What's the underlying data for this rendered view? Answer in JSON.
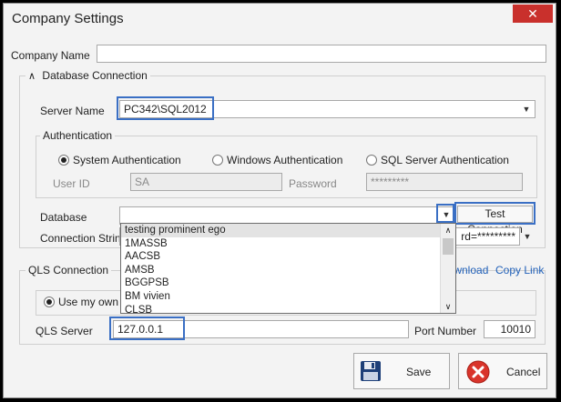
{
  "window": {
    "title": "Company Settings",
    "close_glyph": "✕"
  },
  "company": {
    "label": "Company Name",
    "value": ""
  },
  "db": {
    "group_label": "Database Connection",
    "collapse_glyph": "∧",
    "server_label": "Server Name",
    "server_value": "PC342\\SQL2012",
    "auth": {
      "group_label": "Authentication",
      "options": [
        "System Authentication",
        "Windows Authentication",
        "SQL Server Authentication"
      ],
      "selected": "System Authentication",
      "userid_label": "User ID",
      "userid_value": "SA",
      "password_label": "Password",
      "password_value": "*********"
    },
    "database_label": "Database",
    "database_value": "",
    "test_button": "Test Connection",
    "conn_label": "Connection String",
    "conn_value": "rd=*********",
    "dropdown_items": [
      "testing prominent ego",
      "1MASSB",
      "AACSB",
      "AMSB",
      "BGGPSB",
      "BM vivien",
      "CLSB"
    ]
  },
  "qls": {
    "group_label": "QLS Connection",
    "download_link": "Download",
    "copy_link": "Copy Link",
    "own_server_option": "Use my own server",
    "server_label": "QLS Server",
    "server_value": "127.0.0.1",
    "port_label": "Port Number",
    "port_value": "10010"
  },
  "buttons": {
    "save": "Save",
    "cancel": "Cancel"
  },
  "icons": {
    "save": "floppy-disk-icon",
    "cancel": "cancel-circle-icon"
  },
  "colors": {
    "highlight": "#3a6fc4",
    "close_button": "#c9302c",
    "link": "#1f5fb8",
    "cancel_icon": "#d9342b"
  }
}
